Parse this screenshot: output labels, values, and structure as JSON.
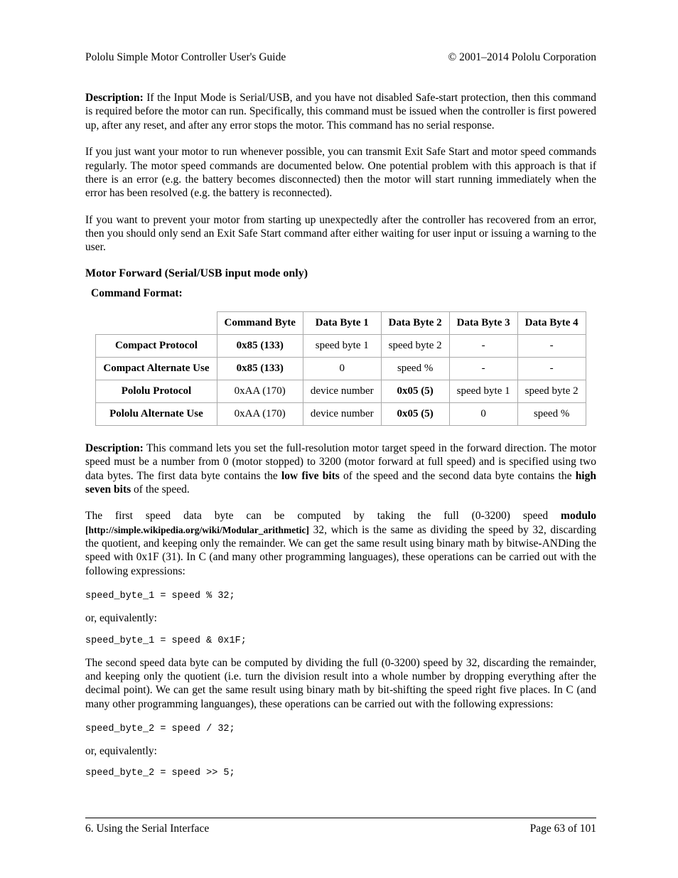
{
  "header": {
    "left": "Pololu Simple Motor Controller User's Guide",
    "right": "© 2001–2014 Pololu Corporation"
  },
  "p1": {
    "label": "Description:",
    "text": " If the Input Mode is Serial/USB, and you have not disabled Safe-start protection, then this command is required before the motor can run. Specifically, this command must be issued when the controller is first powered up, after any reset, and after any error stops the motor. This command has no serial response."
  },
  "p2": "If you just want your motor to run whenever possible, you can transmit Exit Safe Start and motor speed commands regularly. The motor speed commands are documented below. One potential problem with this approach is that if there is an error (e.g. the battery becomes disconnected) then the motor will start running immediately when the error has been resolved (e.g. the battery is reconnected).",
  "p3": "If you want to prevent your motor from starting up unexpectedly after the controller has recovered from an error, then you should only send an Exit Safe Start command after either waiting for user input or issuing a warning to the user.",
  "section_heading": "Motor Forward (Serial/USB input mode only)",
  "subheading": "Command Format:",
  "table": {
    "headers": [
      "",
      "Command Byte",
      "Data Byte 1",
      "Data Byte 2",
      "Data Byte 3",
      "Data Byte 4"
    ],
    "rows": [
      {
        "name": "Compact Protocol",
        "cells": [
          "0x85 (133)",
          "speed byte 1",
          "speed byte 2",
          "-",
          "-"
        ],
        "bold": [
          true,
          false,
          false,
          false,
          false
        ]
      },
      {
        "name": "Compact Alternate Use",
        "cells": [
          "0x85 (133)",
          "0",
          "speed %",
          "-",
          "-"
        ],
        "bold": [
          true,
          false,
          false,
          false,
          false
        ]
      },
      {
        "name": "Pololu Protocol",
        "cells": [
          "0xAA (170)",
          "device number",
          "0x05 (5)",
          "speed byte 1",
          "speed byte 2"
        ],
        "bold": [
          false,
          false,
          true,
          false,
          false
        ]
      },
      {
        "name": "Pololu Alternate Use",
        "cells": [
          "0xAA (170)",
          "device number",
          "0x05 (5)",
          "0",
          "speed %"
        ],
        "bold": [
          false,
          false,
          true,
          false,
          false
        ]
      }
    ]
  },
  "p4": {
    "label": "Description:",
    "t1": " This command lets you set the full-resolution motor target speed in the forward direction. The motor speed must be a number from 0 (motor stopped) to 3200 (motor forward at full speed) and is specified using two data bytes. The first data byte contains the ",
    "b1": "low five bits",
    "t2": " of the speed and the second data byte contains the ",
    "b2": "high seven bits",
    "t3": " of the speed."
  },
  "p5": {
    "t1": "The first speed data byte can be computed by taking the full (0-3200) speed ",
    "b1": "modulo",
    "ref": " [http://simple.wikipedia.org/wiki/Modular_arithmetic]",
    "t2": " 32, which is the same as dividing the speed by 32, discarding the quotient, and keeping only the remainder. We can get the same result using binary math by bitwise-ANDing the speed with 0x1F (31). In C (and many other programming languages), these operations can be carried out with the following expressions:"
  },
  "code1": "speed_byte_1 = speed % 32;",
  "or_eq_1": "or, equivalently:",
  "code2": "speed_byte_1 = speed & 0x1F;",
  "p6": "The second speed data byte can be computed by dividing the full (0-3200) speed by 32, discarding the remainder, and keeping only the quotient (i.e. turn the division result into a whole number by dropping everything after the decimal point). We can get the same result using binary math by bit-shifting the speed right five places. In C (and many other programming languanges), these operations can be carried out with the following expressions:",
  "code3": "speed_byte_2 = speed / 32;",
  "or_eq_2": "or, equivalently:",
  "code4": "speed_byte_2 = speed >> 5;",
  "footer": {
    "left": "6. Using the Serial Interface",
    "right": "Page 63 of 101"
  }
}
